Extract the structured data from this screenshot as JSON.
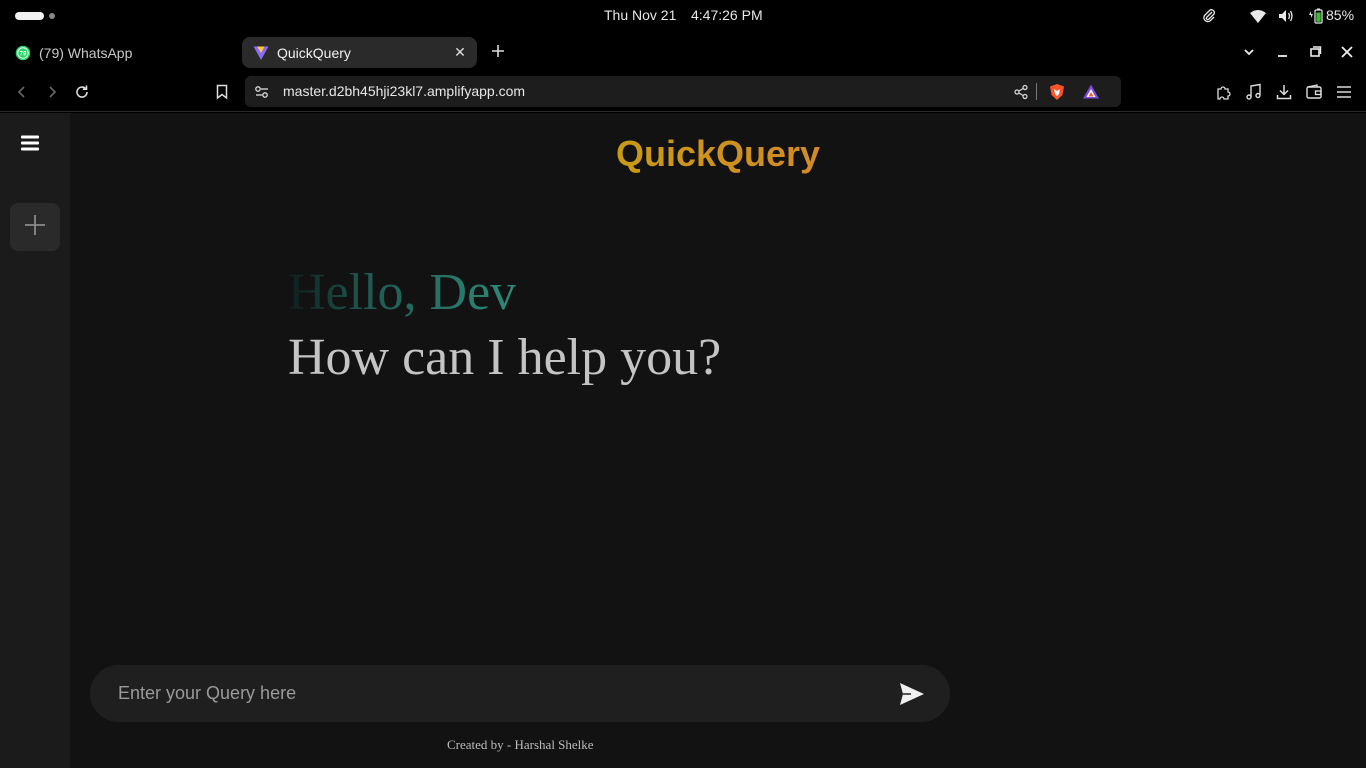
{
  "os": {
    "date": "Thu Nov 21",
    "time": "4:47:26 PM",
    "battery_percent": "85%"
  },
  "browser": {
    "tabs": [
      {
        "label": "(79) WhatsApp",
        "badge": "79",
        "active": false
      },
      {
        "label": "QuickQuery",
        "active": true
      }
    ],
    "url": "master.d2bh45hji23kl7.amplifyapp.com"
  },
  "app": {
    "brand": "QuickQuery",
    "greeting_hello": "Hello, Dev",
    "greeting_help": "How can I help you?",
    "query_placeholder": "Enter your Query here",
    "credit": "Created by - Harshal Shelke"
  },
  "colors": {
    "brand_gold": "#c99a16",
    "greeting_teal": "#2e8a78",
    "whatsapp_green": "#25d366"
  }
}
